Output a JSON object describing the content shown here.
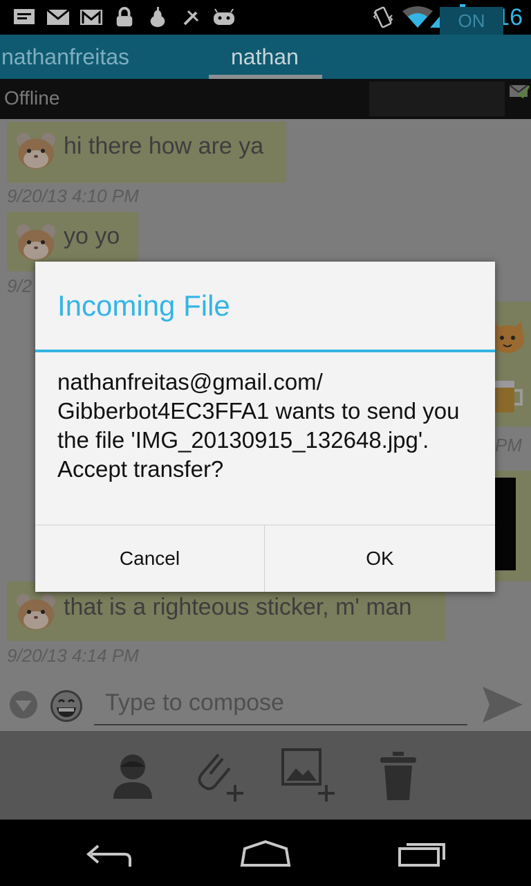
{
  "status_bar": {
    "time": "4:16",
    "icons": [
      "notification-icon",
      "mail-icon",
      "gmail-icon",
      "lock-icon",
      "pear-icon",
      "tools-icon",
      "android-icon",
      "vibrate-icon",
      "wifi-icon",
      "signal-icon",
      "battery-charging-icon"
    ]
  },
  "tabs": [
    {
      "label": "nathanfreitas"
    },
    {
      "label": "nathan"
    }
  ],
  "presence": {
    "status": "Offline",
    "toggle": "ON"
  },
  "messages": [
    {
      "text": "hi there how are ya",
      "timestamp": "9/20/13 4:10 PM"
    },
    {
      "text": "yo yo",
      "timestamp": "9/2"
    },
    {
      "text": "",
      "timestamp": "PM"
    },
    {
      "text": "that is a righteous sticker, m' man",
      "timestamp": "9/20/13 4:14 PM"
    }
  ],
  "composer": {
    "placeholder": "Type to compose"
  },
  "dialog": {
    "title": "Incoming File",
    "message": "nathanfreitas@gmail.com/ Gibberbot4EC3FFA1 wants to send you the file 'IMG_20130915_132648.jpg'. Accept transfer?",
    "cancel_label": "Cancel",
    "ok_label": "OK"
  },
  "colors": {
    "accent": "#33b5e5",
    "dialog_bg": "#f3f3f3",
    "bubble": "#7a7e5c"
  }
}
